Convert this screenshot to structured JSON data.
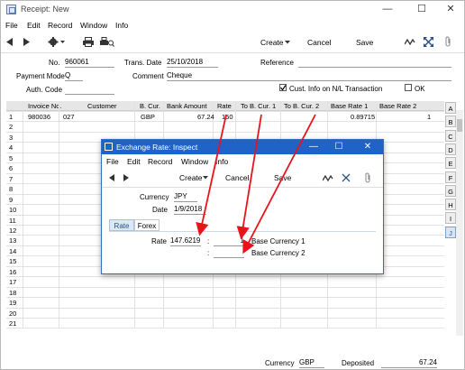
{
  "window": {
    "title": "Receipt: New",
    "controls": {
      "minimize": "—",
      "maximize": "☐",
      "close": "✕"
    }
  },
  "menu": [
    "File",
    "Edit",
    "Record",
    "Window",
    "Info"
  ],
  "toolbar": {
    "create": "Create",
    "cancel": "Cancel",
    "save": "Save"
  },
  "header": {
    "no_label": "No.",
    "no_value": "960061",
    "trans_date_label": "Trans. Date",
    "trans_date_value": "25/10/2018",
    "reference_label": "Reference",
    "reference_value": "",
    "payment_mode_label": "Payment Mode",
    "payment_mode_value": "Q",
    "comment_label": "Comment",
    "comment_value": "Cheque",
    "auth_code_label": "Auth. Code",
    "auth_code_value": "",
    "cust_info_label": "Cust. Info on N/L Transaction",
    "cust_info_checked": true,
    "ok_label": "OK",
    "ok_checked": false
  },
  "grid": {
    "columns": [
      "Invoice No.",
      "Customer",
      "B. Cur.",
      "Bank Amount",
      "Rate",
      "To B. Cur. 1",
      "To B. Cur. 2",
      "Base Rate 1",
      "Base Rate 2"
    ],
    "row_numbers": [
      "1",
      "2",
      "3",
      "4",
      "5",
      "6",
      "7",
      "8",
      "9",
      "10",
      "11",
      "12",
      "13",
      "14",
      "15",
      "16",
      "17",
      "18",
      "19",
      "20",
      "21"
    ],
    "rows": [
      {
        "invoice": "980036",
        "customer": "027",
        "bcur": "GBP",
        "bank_amount": "67.24",
        "rate": "150",
        "to_b_cur_1": "",
        "to_b_cur_2": "",
        "base_rate_1": "0.89715",
        "base_rate_2": "1"
      }
    ],
    "tabs": [
      "A",
      "B",
      "C",
      "D",
      "E",
      "F",
      "G",
      "H",
      "I",
      "J"
    ],
    "active_tab": "J"
  },
  "footer": {
    "currency_label": "Currency",
    "currency_value": "GBP",
    "deposited_label": "Deposited",
    "deposited_value": "67.24"
  },
  "dialog": {
    "title": "Exchange Rate: Inspect",
    "menu": [
      "File",
      "Edit",
      "Record",
      "Window",
      "Info"
    ],
    "toolbar": {
      "create": "Create",
      "cancel": "Cancel",
      "save": "Save"
    },
    "currency_label": "Currency",
    "currency_value": "JPY",
    "date_label": "Date",
    "date_value": "1/9/2018",
    "tabs": [
      "Rate",
      "Forex"
    ],
    "active_tab": "Rate",
    "rate_label": "Rate",
    "rate_value": "147.6219",
    "colon": ":",
    "base1_value": "1",
    "base1_label": "Base Currency 1",
    "base2_value": "",
    "base2_label": "Base Currency 2"
  },
  "colors": {
    "accent": "#1f63c6",
    "arrow": "#e8141c",
    "tab_active": "#2a5ba8"
  }
}
